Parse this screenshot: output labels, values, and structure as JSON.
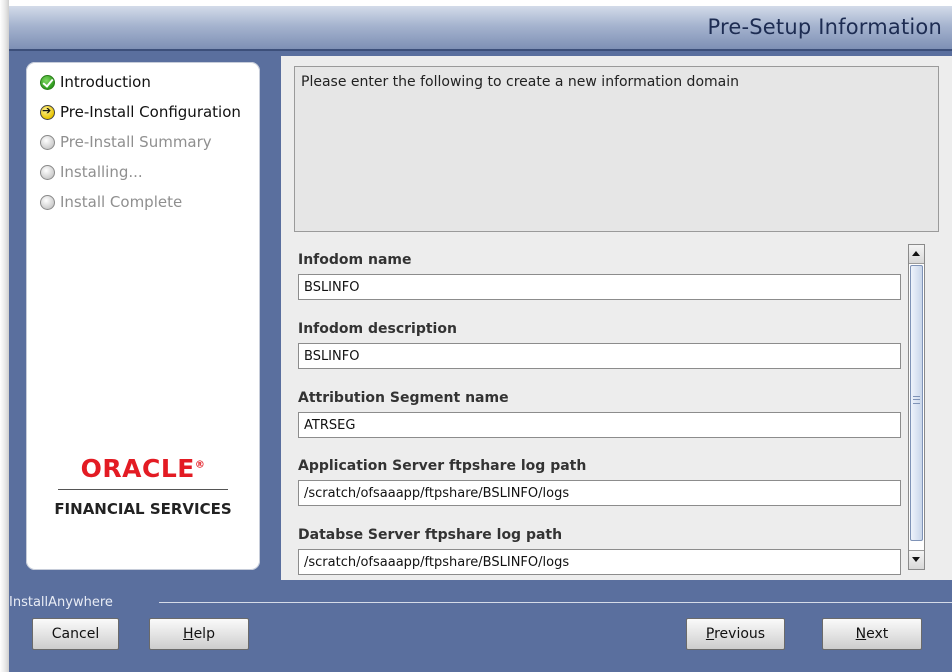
{
  "window": {
    "title": "Pre-Setup Information"
  },
  "steps": [
    {
      "label": "Introduction",
      "state": "done"
    },
    {
      "label": "Pre-Install Configuration",
      "state": "current"
    },
    {
      "label": "Pre-Install Summary",
      "state": "pending"
    },
    {
      "label": "Installing...",
      "state": "pending"
    },
    {
      "label": "Install Complete",
      "state": "pending"
    }
  ],
  "branding": {
    "oracle": "ORACLE",
    "trademark": "®",
    "subtitle": "FINANCIAL SERVICES",
    "installer": "InstallAnywhere"
  },
  "main": {
    "description": "Please enter the following to create a new information domain",
    "fields": [
      {
        "label": "Infodom name",
        "value": "BSLINFO"
      },
      {
        "label": "Infodom description",
        "value": "BSLINFO"
      },
      {
        "label": "Attribution Segment name",
        "value": "ATRSEG"
      },
      {
        "label": "Application Server ftpshare log path",
        "value": "/scratch/ofsaaapp/ftpshare/BSLINFO/logs"
      },
      {
        "label": "Databse Server ftpshare log path",
        "value": "/scratch/ofsaaapp/ftpshare/BSLINFO/logs"
      }
    ]
  },
  "buttons": {
    "cancel": "Cancel",
    "help_mnemonic": "H",
    "help_rest": "elp",
    "previous_mnemonic": "P",
    "previous_rest": "revious",
    "next_mnemonic": "N",
    "next_rest": "ext"
  },
  "colors": {
    "background": "#5a6f9e",
    "header_title": "#1d2c52",
    "oracle_red": "#e31b23",
    "step_done": "#2f9c1e",
    "step_current": "#e8c400"
  },
  "icons": [
    "checkmark-icon",
    "arrow-right-icon",
    "radio-empty-icon",
    "scroll-up-arrow-icon",
    "scroll-down-arrow-icon"
  ]
}
